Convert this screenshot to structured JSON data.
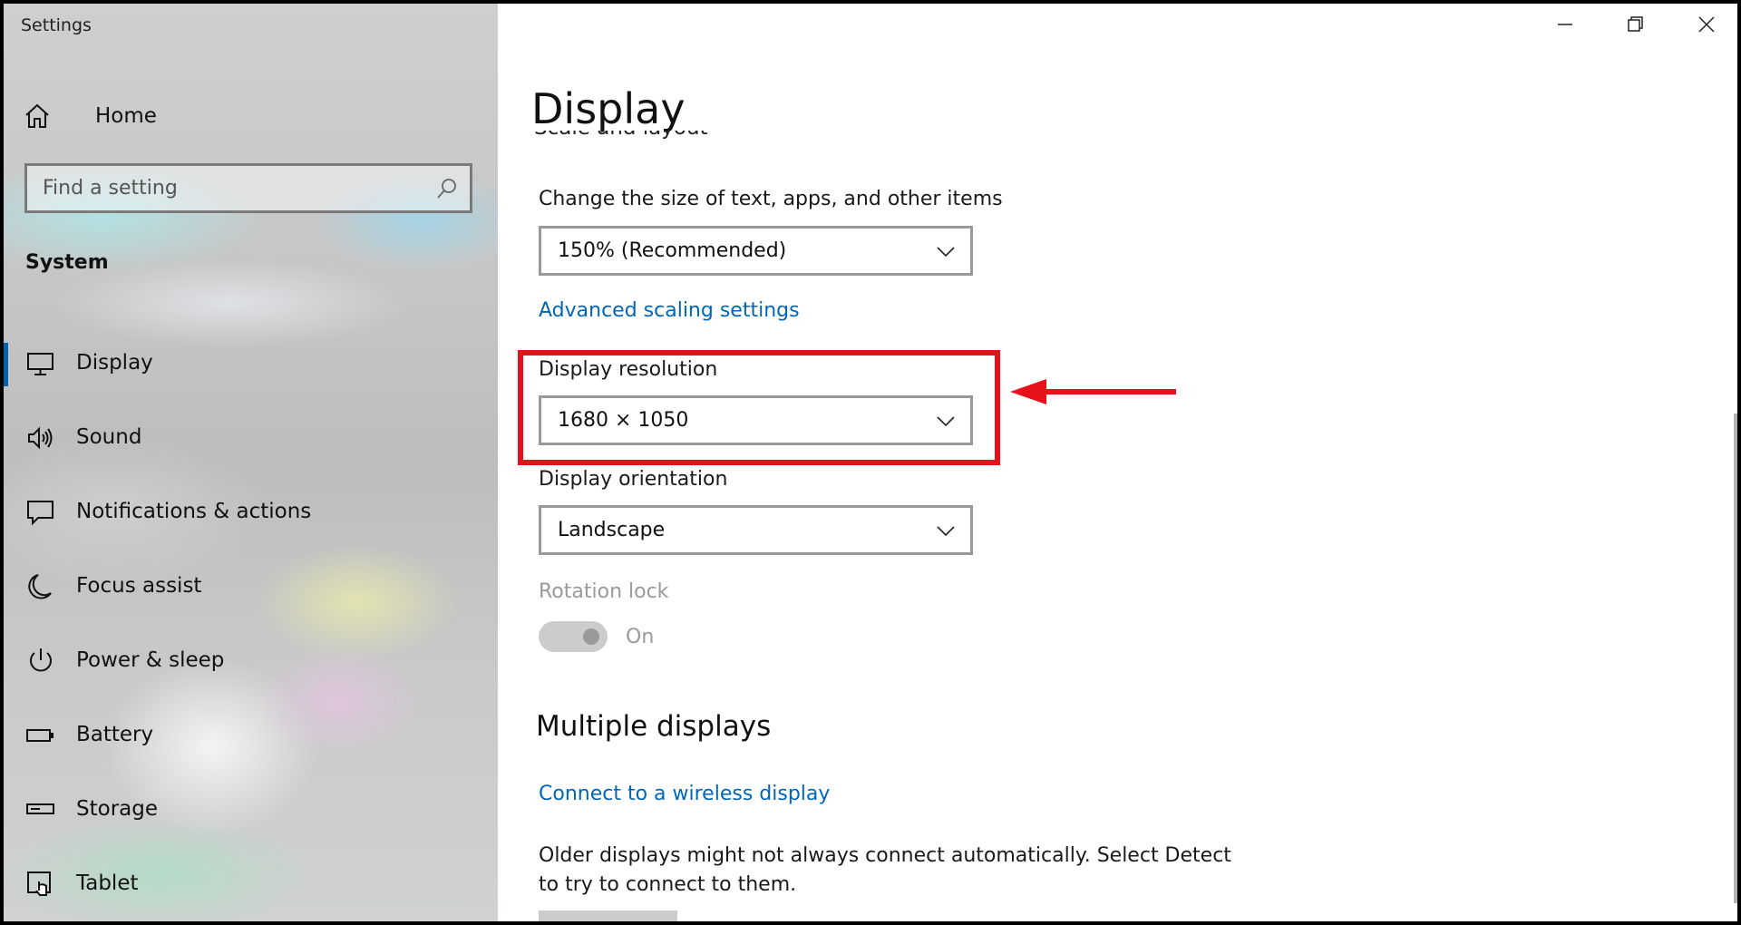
{
  "window": {
    "app_title": "Settings",
    "buttons": {
      "minimize": "minimize-icon",
      "restore": "restore-icon",
      "close": "close-icon"
    }
  },
  "sidebar": {
    "home_label": "Home",
    "search_placeholder": "Find a setting",
    "section_title": "System",
    "items": [
      {
        "label": "Display",
        "icon": "monitor-icon",
        "selected": true
      },
      {
        "label": "Sound",
        "icon": "speaker-icon",
        "selected": false
      },
      {
        "label": "Notifications & actions",
        "icon": "message-icon",
        "selected": false
      },
      {
        "label": "Focus assist",
        "icon": "moon-icon",
        "selected": false
      },
      {
        "label": "Power & sleep",
        "icon": "power-icon",
        "selected": false
      },
      {
        "label": "Battery",
        "icon": "battery-icon",
        "selected": false
      },
      {
        "label": "Storage",
        "icon": "storage-icon",
        "selected": false
      },
      {
        "label": "Tablet",
        "icon": "tablet-icon",
        "selected": false
      }
    ]
  },
  "main": {
    "page_title": "Display",
    "cut_heading": "Scale and layout",
    "scale": {
      "label": "Change the size of text, apps, and other items",
      "value": "150% (Recommended)"
    },
    "advanced_scaling_link": "Advanced scaling settings",
    "resolution": {
      "label": "Display resolution",
      "value": "1680 × 1050"
    },
    "orientation": {
      "label": "Display orientation",
      "value": "Landscape"
    },
    "rotation_lock": {
      "label": "Rotation lock",
      "state": "On",
      "enabled": false
    },
    "multiple_displays": {
      "heading": "Multiple displays",
      "wireless_link": "Connect to a wireless display",
      "description": "Older displays might not always connect automatically. Select Detect to try to connect to them."
    }
  },
  "colors": {
    "accent": "#0063b1",
    "link": "#0067b8",
    "highlight": "#e8101a"
  }
}
